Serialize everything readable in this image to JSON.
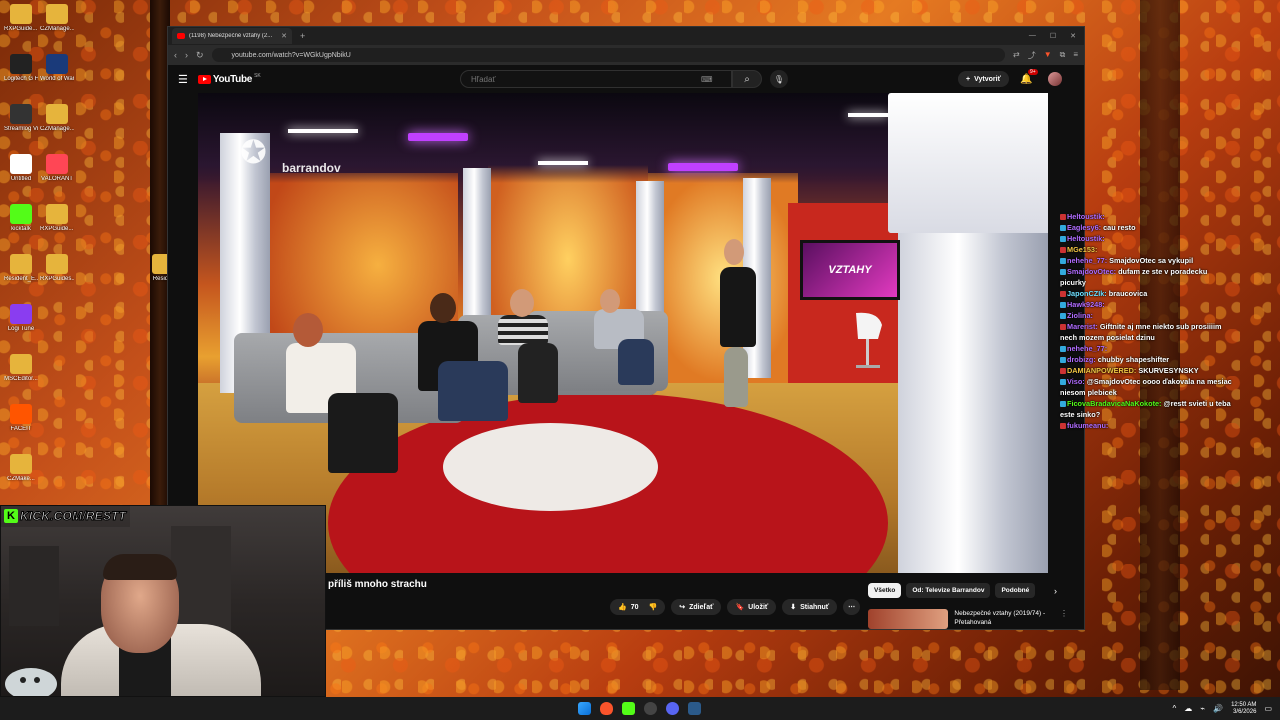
{
  "desktop": {
    "icons": [
      {
        "label": "RXPGuide... Cracked",
        "color": "#e6b43c"
      },
      {
        "label": "CZManage...",
        "color": "#e6b43c"
      },
      {
        "label": "Logitech G HUB",
        "color": "#222222"
      },
      {
        "label": "World of Warcraft",
        "color": "#1a3a7a"
      },
      {
        "label": "Streamlog VirtualCam",
        "color": "#333333"
      },
      {
        "label": "CZManage...",
        "color": "#e6b43c"
      },
      {
        "label": "Untitled",
        "color": "#ffffff"
      },
      {
        "label": "VALORANT",
        "color": "#ff4655"
      },
      {
        "label": "kicktalk",
        "color": "#53fc18"
      },
      {
        "label": "RXPGuide... Cracked",
        "color": "#e6b43c"
      },
      {
        "label": "Resident_E...",
        "color": "#e6b43c"
      },
      {
        "label": "RXPGuides...",
        "color": "#e6b43c"
      },
      {
        "label": "Logi Tune",
        "color": "#8a3df0"
      },
      {
        "label": "MSCEditor...",
        "color": "#e6b43c"
      },
      {
        "label": "FACEIT",
        "color": "#ff5500"
      },
      {
        "label": "CZMake...",
        "color": "#e6b43c"
      },
      {
        "label": "Resid...",
        "color": "#e6b43c"
      }
    ]
  },
  "browser": {
    "tab_title": "(1198) Nebezpečné vztahy (2...",
    "url": "youtube.com/watch?v=WGkUgpNbikU"
  },
  "youtube": {
    "logo_text": "YouTube",
    "country": "SK",
    "search_placeholder": "Hľadať",
    "create_label": "Vytvoriť",
    "notif_count": "9+",
    "video_title": "příliš mnoho strachu",
    "like_count": "70",
    "share_label": "Zdieľať",
    "save_label": "Uložiť",
    "download_label": "Stiahnuť",
    "chips": [
      "Všetko",
      "Od: Televize Barrandov",
      "Podobné"
    ],
    "rec_title": "Nebezpečné vztahy (2019/74) - Přetahovaná",
    "channel_logo": "barrandov",
    "set_screen_text": "VZTAHY"
  },
  "chat": [
    {
      "user": "Heltoustik:",
      "text": "",
      "color": "#b06cff"
    },
    {
      "user": "Eaglesy6:",
      "text": "cau resto",
      "color": "#b06cff"
    },
    {
      "user": "Heltoustik:",
      "text": "",
      "color": "#b06cff"
    },
    {
      "user": "MGe153:",
      "text": "",
      "color": "#f2c744"
    },
    {
      "user": "nehehe_77:",
      "text": "SmajdovOtec sa vykupil",
      "color": "#b06cff"
    },
    {
      "user": "SmajdovOtec:",
      "text": "dufam ze ste v poradecku picurky",
      "color": "#b06cff"
    },
    {
      "user": "JaponCZIk:",
      "text": "braucovica",
      "color": "#6ee0ff"
    },
    {
      "user": "Hawk9248:",
      "text": "",
      "color": "#b06cff"
    },
    {
      "user": "Ziolina:",
      "text": "",
      "color": "#b06cff"
    },
    {
      "user": "Marerist:",
      "text": "Giftnite aj mne niekto sub prosiiiim nech mozem posielat dzinu",
      "color": "#b06cff"
    },
    {
      "user": "nehehe_77:",
      "text": "",
      "color": "#b06cff"
    },
    {
      "user": "drobizg:",
      "text": "chubby shapeshifter",
      "color": "#b06cff"
    },
    {
      "user": "DAMIANPOWERED:",
      "text": "SKURVESYNSKY",
      "color": "#f2c744"
    },
    {
      "user": "Viso:",
      "text": "@SmajdovOtec oooo ďakovala na mesiac niesom plebicek",
      "color": "#b06cff"
    },
    {
      "user": "FicovaBradavicaNaKokote:",
      "text": "@restt svieti u teba este sinko?",
      "color": "#53fc18"
    },
    {
      "user": "fukumeanu:",
      "text": "",
      "color": "#b06cff"
    }
  ],
  "webcam": {
    "banner": "KICK.COM/RESTT"
  },
  "taskbar": {
    "time": "12:50 AM",
    "date": "3/6/2026"
  }
}
